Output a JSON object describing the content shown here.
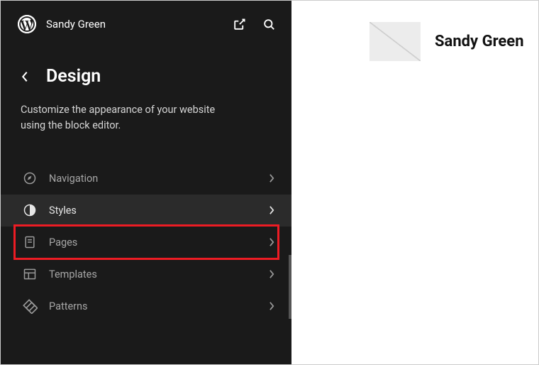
{
  "site_title": "Sandy Green",
  "heading": "Design",
  "description": "Customize the appearance of your website using the block editor.",
  "menu": {
    "navigation": "Navigation",
    "styles": "Styles",
    "pages": "Pages",
    "templates": "Templates",
    "patterns": "Patterns"
  },
  "preview": {
    "title": "Sandy Green"
  }
}
